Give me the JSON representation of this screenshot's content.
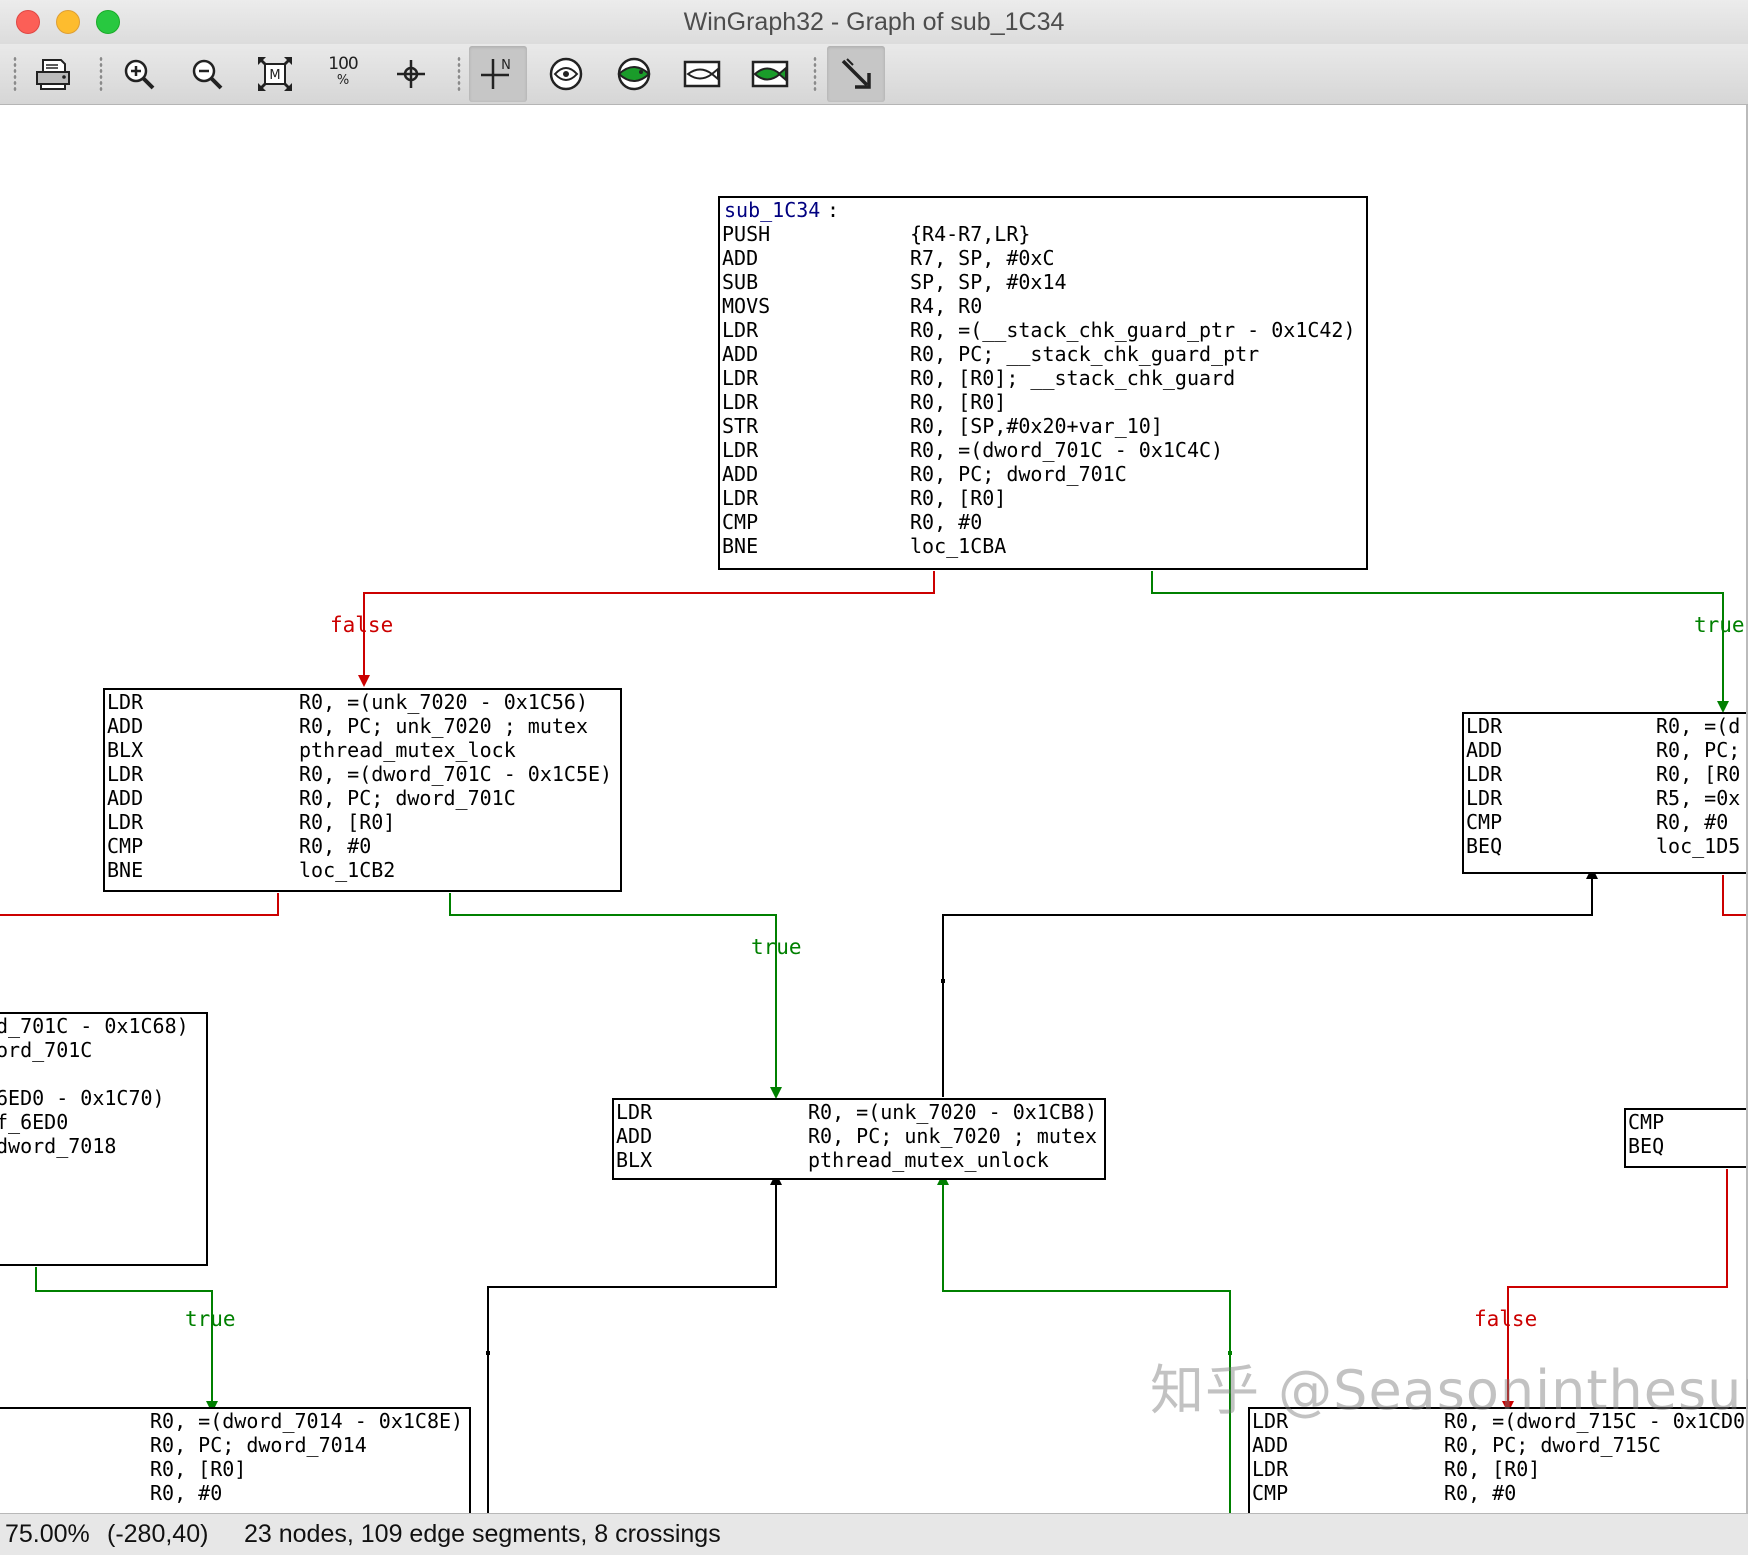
{
  "window": {
    "title": "WinGraph32 - Graph of sub_1C34"
  },
  "toolbar": {
    "buttons": [
      {
        "name": "print-icon",
        "tooltip": ""
      },
      {
        "name": "zoom-in-icon"
      },
      {
        "name": "zoom-out-icon"
      },
      {
        "name": "fit-window-icon"
      },
      {
        "name": "zoom-100-icon",
        "label": "100\n%"
      },
      {
        "name": "center-crosshair-icon"
      },
      {
        "name": "north-cross-icon",
        "label": "N"
      },
      {
        "name": "overview-icon"
      },
      {
        "name": "fish-green-icon"
      },
      {
        "name": "fish-outline-icon"
      },
      {
        "name": "fish-green-2-icon"
      },
      {
        "name": "pointer-arrow-icon"
      }
    ],
    "zoom100_label_top": "100",
    "zoom100_label_bottom": "%",
    "north_label": "N"
  },
  "graph": {
    "nodes": {
      "entry": {
        "label": "sub_1C34",
        "label_suffix": ":",
        "rows": [
          [
            "PUSH",
            "{R4-R7,LR}"
          ],
          [
            "ADD",
            "R7, SP, #0xC"
          ],
          [
            "SUB",
            "SP, SP, #0x14"
          ],
          [
            "MOVS",
            "R4, R0"
          ],
          [
            "LDR",
            "R0, =(__stack_chk_guard_ptr - 0x1C42)"
          ],
          [
            "ADD",
            "R0, PC; __stack_chk_guard_ptr"
          ],
          [
            "LDR",
            "R0, [R0]; __stack_chk_guard"
          ],
          [
            "LDR",
            "R0, [R0]"
          ],
          [
            "STR",
            "R0, [SP,#0x20+var_10]"
          ],
          [
            "LDR",
            "R0, =(dword_701C - 0x1C4C)"
          ],
          [
            "ADD",
            "R0, PC; dword_701C"
          ],
          [
            "LDR",
            "R0, [R0]"
          ],
          [
            "CMP",
            "R0, #0"
          ],
          [
            "BNE",
            "loc_1CBA"
          ]
        ]
      },
      "mutex_lock": {
        "rows": [
          [
            "LDR",
            "R0, =(unk_7020 - 0x1C56)"
          ],
          [
            "ADD",
            "R0, PC; unk_7020 ; mutex"
          ],
          [
            "BLX",
            "pthread_mutex_lock"
          ],
          [
            "LDR",
            "R0, =(dword_701C - 0x1C5E)"
          ],
          [
            "ADD",
            "R0, PC; dword_701C"
          ],
          [
            "LDR",
            "R0, [R0]"
          ],
          [
            "CMP",
            "R0, #0"
          ],
          [
            "BNE",
            "loc_1CB2"
          ]
        ]
      },
      "right_top": {
        "rows": [
          [
            "LDR",
            "R0, =(d"
          ],
          [
            "ADD",
            "R0, PC;"
          ],
          [
            "LDR",
            "R0, [R0"
          ],
          [
            "LDR",
            "R5, =0x"
          ],
          [
            "CMP",
            "R0, #0"
          ],
          [
            "BEQ",
            "loc_1D5"
          ]
        ]
      },
      "left_mid": {
        "rows": [
          [
            "",
            "d_701C - 0x1C68)"
          ],
          [
            "",
            "ord_701C"
          ],
          [
            "",
            ""
          ],
          [
            "",
            "6ED0 - 0x1C70)"
          ],
          [
            "",
            "f_6ED0"
          ],
          [
            "",
            "dword_7018"
          ]
        ]
      },
      "mutex_unlock": {
        "rows": [
          [
            "LDR",
            "R0, =(unk_7020 - 0x1CB8)"
          ],
          [
            "ADD",
            "R0, PC; unk_7020 ; mutex"
          ],
          [
            "BLX",
            "pthread_mutex_unlock"
          ]
        ]
      },
      "right_mid": {
        "rows": [
          [
            "CMP",
            ""
          ],
          [
            "BEQ",
            ""
          ]
        ]
      },
      "bottom_left": {
        "rows": [
          [
            "",
            "R0, =(dword_7014 - 0x1C8E)"
          ],
          [
            "",
            "R0, PC; dword_7014"
          ],
          [
            "",
            "R0, [R0]"
          ],
          [
            "",
            "R0, #0"
          ]
        ]
      },
      "bottom_right": {
        "rows": [
          [
            "LDR",
            "R0, =(dword_715C - 0x1CD0"
          ],
          [
            "ADD",
            "R0, PC; dword_715C"
          ],
          [
            "LDR",
            "R0, [R0]"
          ],
          [
            "CMP",
            "R0, #0"
          ]
        ]
      }
    },
    "edge_labels": {
      "false_1": "false",
      "true_1": "true",
      "true_2": "true",
      "true_3": "true",
      "false_2": "false"
    },
    "colors": {
      "false_edge": "#cc0000",
      "true_edge": "#008000",
      "normal_edge": "#000000",
      "label_text": "#000080"
    }
  },
  "watermark": "知乎 @Seasoninthesun",
  "status": {
    "zoom": "75.00%",
    "coords": "(-280,40)",
    "stats": "23 nodes, 109 edge segments, 8 crossings"
  }
}
